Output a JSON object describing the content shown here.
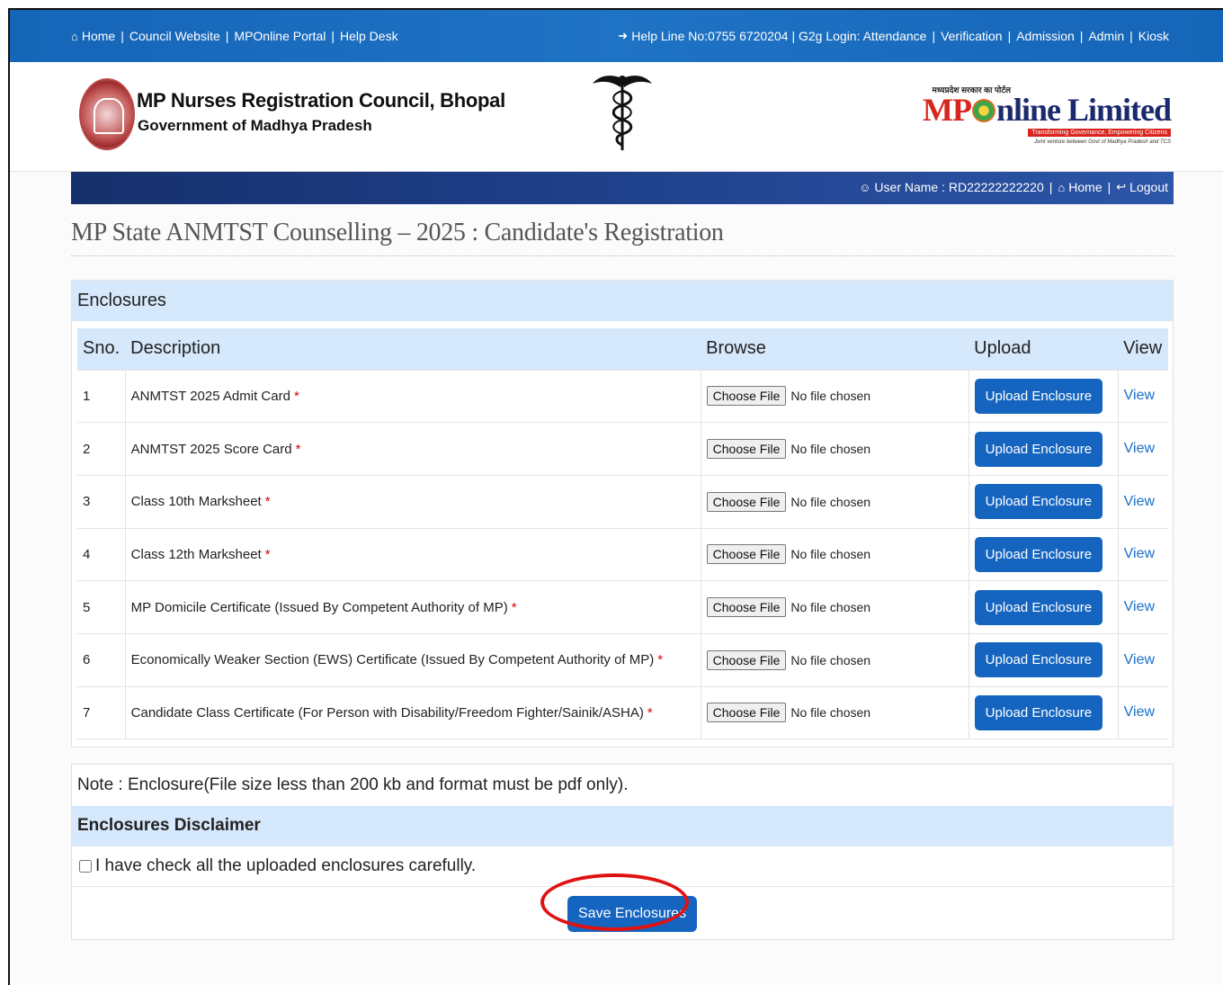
{
  "topbar": {
    "left_links": [
      "Home",
      "Council Website",
      "MPOnline Portal",
      "Help Desk"
    ],
    "helpline": "Help Line No:0755 6720204 | G2g Login: Attendance",
    "right_links": [
      "Verification",
      "Admission",
      "Admin",
      "Kiosk"
    ]
  },
  "header": {
    "org_name": "MP Nurses Registration Council, Bhopal",
    "org_sub": "Government of Madhya Pradesh",
    "mp_small": "मध्यप्रदेश सरकार का पोर्टल",
    "mp_logo_mp": "MP",
    "mp_logo_rest": "nline Limited",
    "mp_tagline": "Transforming Governance, Empowering Citizens",
    "mp_tagline2": "Joint venture between Govt of Madhya Pradesh and TCS"
  },
  "userbar": {
    "username": "User Name : RD22222222220",
    "home": "Home",
    "logout": "Logout"
  },
  "page_title": "MP State ANMTST Counselling – 2025 : Candidate's Registration",
  "enclosures": {
    "heading": "Enclosures",
    "columns": [
      "Sno.",
      "Description",
      "Browse",
      "Upload",
      "View"
    ],
    "choose_label": "Choose File",
    "no_file": "No file chosen",
    "upload_label": "Upload Enclosure",
    "view_label": "View",
    "rows": [
      {
        "sno": "1",
        "desc": "ANMTST 2025 Admit Card"
      },
      {
        "sno": "2",
        "desc": "ANMTST 2025 Score Card"
      },
      {
        "sno": "3",
        "desc": "Class 10th Marksheet"
      },
      {
        "sno": "4",
        "desc": "Class 12th Marksheet"
      },
      {
        "sno": "5",
        "desc": "MP Domicile Certificate (Issued By Competent Authority of MP)"
      },
      {
        "sno": "6",
        "desc": "Economically Weaker Section (EWS) Certificate (Issued By Competent Authority of MP)"
      },
      {
        "sno": "7",
        "desc": "Candidate Class Certificate (For Person with Disability/Freedom Fighter/Sainik/ASHA)"
      }
    ]
  },
  "note": "Note : Enclosure(File size less than 200 kb and format must be pdf only).",
  "disclaimer": {
    "heading": "Enclosures Disclaimer",
    "checkbox_label": "I have check all the uploaded enclosures carefully.",
    "checked": false
  },
  "save_label": "Save Enclosures",
  "colors": {
    "topbar": "#1f73c4",
    "button": "#1565c0",
    "panel_head": "#d6e8fb",
    "highlight_ring": "#e01212"
  }
}
